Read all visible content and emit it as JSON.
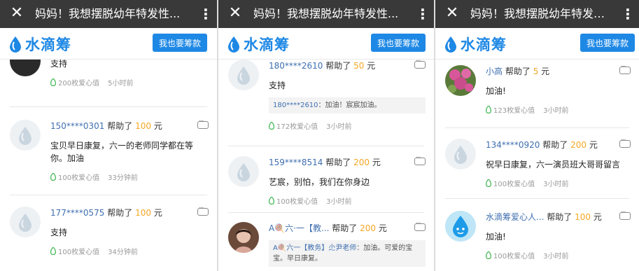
{
  "colors": {
    "topbar": "#393939",
    "brand_blue": "#1e88e5",
    "name_blue": "#3f6fb0",
    "amount_orange": "#f5a623",
    "leaf_green": "#39b54a"
  },
  "panels": [
    {
      "title": "妈妈！我想摆脱幼年特发性...",
      "brand": "水滴筹",
      "button": "我也要筹款",
      "items": [
        {
          "partial_msg": "支持",
          "hearts": "200枚爱心值",
          "time": "5小时前"
        },
        {
          "name": "150****0301",
          "helped": "帮助了",
          "amount": "100",
          "unit": "元",
          "msg": "宝贝早日康复，六一的老师同学都在等你。加油",
          "hearts": "100枚爱心值",
          "time": "33分钟前"
        },
        {
          "name": "177****0575",
          "helped": "帮助了",
          "amount": "100",
          "unit": "元",
          "msg": "支持",
          "hearts": "100枚爱心值",
          "time": "34分钟前"
        }
      ]
    },
    {
      "title": "妈妈！我想摆脱幼年特发性...",
      "brand": "水滴筹",
      "button": "我也要筹款",
      "items": [
        {
          "name": "180****2610",
          "helped": "帮助了",
          "amount": "50",
          "unit": "元",
          "msg": "支持",
          "reply_name": "180****2610",
          "reply_text": "：加油！宸宸加油。",
          "hearts": "172枚爱心值",
          "time": "3小时前"
        },
        {
          "name": "159****8514",
          "helped": "帮助了",
          "amount": "200",
          "unit": "元",
          "msg": "艺宸，别怕，我们在你身边",
          "hearts": "100枚爱心值",
          "time": "3小时前"
        },
        {
          "name": "A🍭六·一【教...",
          "helped": "帮助了",
          "amount": "200",
          "unit": "元",
          "reply_name": "A🍭六一【教务】尐尹老师",
          "reply_text": "：加油。可爱的宝宝。早日康复。"
        }
      ]
    },
    {
      "title": "妈妈！我想摆脱幼年特发性...",
      "brand": "水滴筹",
      "button": "我也要筹款",
      "items": [
        {
          "name": "小高",
          "helped": "帮助了",
          "amount": "5",
          "unit": "元",
          "msg": "加油!",
          "hearts": "123枚爱心值",
          "time": "3小时前"
        },
        {
          "name": "134****0920",
          "helped": "帮助了",
          "amount": "200",
          "unit": "元",
          "msg": "祝早日康复，六一演员班大哥哥留言",
          "hearts": "100枚爱心值",
          "time": "3小时前"
        },
        {
          "name": "水滴筹爱心人...",
          "helped": "帮助了",
          "amount": "100",
          "unit": "元",
          "msg": "加油!",
          "hearts": "100枚爱心值",
          "time": "3小时前"
        }
      ]
    }
  ]
}
